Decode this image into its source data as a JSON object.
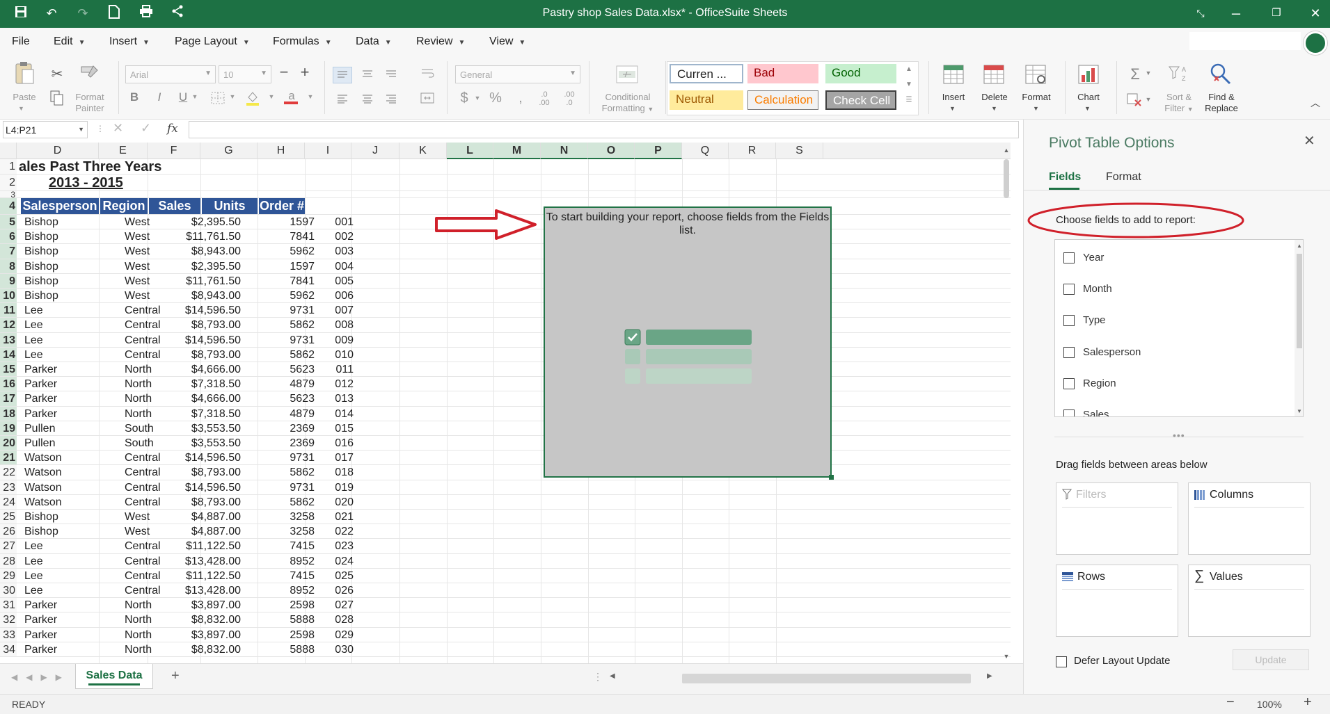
{
  "window": {
    "title": "Pastry shop Sales Data.xlsx* - OfficeSuite Sheets"
  },
  "menu": [
    "File",
    "Edit",
    "Insert",
    "Page Layout",
    "Formulas",
    "Data",
    "Review",
    "View"
  ],
  "ribbon": {
    "paste": "Paste",
    "format_painter": [
      "Format",
      "Painter"
    ],
    "font_name": "Arial",
    "font_size": "10",
    "number_format": "General",
    "conditional_formatting": [
      "Conditional",
      "Formatting"
    ],
    "styles": {
      "currency": "Curren ...",
      "bad": "Bad",
      "good": "Good",
      "neutral": "Neutral",
      "calculation": "Calculation",
      "check_cell": "Check Cell"
    },
    "insert": "Insert",
    "delete": "Delete",
    "format": "Format",
    "chart": "Chart",
    "sort_filter": [
      "Sort &",
      "Filter"
    ],
    "find_replace": [
      "Find &",
      "Replace"
    ]
  },
  "formula_bar": {
    "name_box": "L4:P21",
    "fx": "fx",
    "value": ""
  },
  "columns": [
    "D",
    "E",
    "F",
    "G",
    "H",
    "I",
    "J",
    "K",
    "L",
    "M",
    "N",
    "O",
    "P",
    "Q",
    "R",
    "S"
  ],
  "sheet": {
    "title1": "ales Past Three Years",
    "title2": "2013 - 2015",
    "headers": [
      "Salesperson",
      "Region",
      "Sales",
      "Units",
      "Order #"
    ],
    "rows": [
      [
        "Bishop",
        "West",
        "$2,395.50",
        "1597",
        "001"
      ],
      [
        "Bishop",
        "West",
        "$11,761.50",
        "7841",
        "002"
      ],
      [
        "Bishop",
        "West",
        "$8,943.00",
        "5962",
        "003"
      ],
      [
        "Bishop",
        "West",
        "$2,395.50",
        "1597",
        "004"
      ],
      [
        "Bishop",
        "West",
        "$11,761.50",
        "7841",
        "005"
      ],
      [
        "Bishop",
        "West",
        "$8,943.00",
        "5962",
        "006"
      ],
      [
        "Lee",
        "Central",
        "$14,596.50",
        "9731",
        "007"
      ],
      [
        "Lee",
        "Central",
        "$8,793.00",
        "5862",
        "008"
      ],
      [
        "Lee",
        "Central",
        "$14,596.50",
        "9731",
        "009"
      ],
      [
        "Lee",
        "Central",
        "$8,793.00",
        "5862",
        "010"
      ],
      [
        "Parker",
        "North",
        "$4,666.00",
        "5623",
        "011"
      ],
      [
        "Parker",
        "North",
        "$7,318.50",
        "4879",
        "012"
      ],
      [
        "Parker",
        "North",
        "$4,666.00",
        "5623",
        "013"
      ],
      [
        "Parker",
        "North",
        "$7,318.50",
        "4879",
        "014"
      ],
      [
        "Pullen",
        "South",
        "$3,553.50",
        "2369",
        "015"
      ],
      [
        "Pullen",
        "South",
        "$3,553.50",
        "2369",
        "016"
      ],
      [
        "Watson",
        "Central",
        "$14,596.50",
        "9731",
        "017"
      ],
      [
        "Watson",
        "Central",
        "$8,793.00",
        "5862",
        "018"
      ],
      [
        "Watson",
        "Central",
        "$14,596.50",
        "9731",
        "019"
      ],
      [
        "Watson",
        "Central",
        "$8,793.00",
        "5862",
        "020"
      ],
      [
        "Bishop",
        "West",
        "$4,887.00",
        "3258",
        "021"
      ],
      [
        "Bishop",
        "West",
        "$4,887.00",
        "3258",
        "022"
      ],
      [
        "Lee",
        "Central",
        "$11,122.50",
        "7415",
        "023"
      ],
      [
        "Lee",
        "Central",
        "$13,428.00",
        "8952",
        "024"
      ],
      [
        "Lee",
        "Central",
        "$11,122.50",
        "7415",
        "025"
      ],
      [
        "Lee",
        "Central",
        "$13,428.00",
        "8952",
        "026"
      ],
      [
        "Parker",
        "North",
        "$3,897.00",
        "2598",
        "027"
      ],
      [
        "Parker",
        "North",
        "$8,832.00",
        "5888",
        "028"
      ],
      [
        "Parker",
        "North",
        "$3,897.00",
        "2598",
        "029"
      ],
      [
        "Parker",
        "North",
        "$8,832.00",
        "5888",
        "030"
      ]
    ]
  },
  "pivot_placeholder": {
    "message": "To start building your report, choose fields from the Fields list."
  },
  "sheet_tab": "Sales Data",
  "status": {
    "state": "READY",
    "zoom": "100%"
  },
  "pane": {
    "title": "Pivot Table Options",
    "tabs": [
      "Fields",
      "Format"
    ],
    "choose_label": "Choose fields to add to report:",
    "fields": [
      "Year",
      "Month",
      "Type",
      "Salesperson",
      "Region",
      "Sales"
    ],
    "drag_label": "Drag fields between areas below",
    "areas": {
      "filters": "Filters",
      "columns": "Columns",
      "rows": "Rows",
      "values": "Values"
    },
    "defer_label": "Defer Layout Update",
    "update_button": "Update"
  },
  "colors": {
    "accent": "#1d7144",
    "header_fill": "#2f5597",
    "annotation": "#d0202a"
  }
}
